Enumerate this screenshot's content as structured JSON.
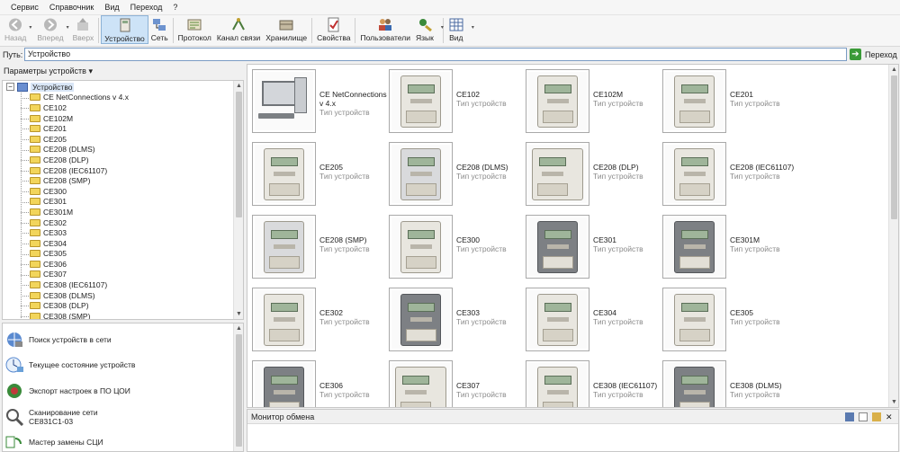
{
  "menu": [
    "Сервис",
    "Справочник",
    "Вид",
    "Переход",
    "?"
  ],
  "toolbar": {
    "back": "Назад",
    "forward": "Вперед",
    "up": "Вверх",
    "device": "Устройство",
    "network": "Сеть",
    "protocol": "Протокол",
    "channel": "Канал связи",
    "storage": "Хранилище",
    "properties": "Свойства",
    "users": "Пользователи",
    "language": "Язык",
    "view": "Вид"
  },
  "path": {
    "label": "Путь:",
    "value": "Устройство",
    "go_label": "Переход"
  },
  "left_panel": {
    "header": "Параметры устройств ▾",
    "tree_root": "Устройство",
    "tree_items": [
      "CE NetConnections v 4.x",
      "CE102",
      "CE102M",
      "CE201",
      "CE205",
      "CE208 (DLMS)",
      "CE208 (DLP)",
      "CE208 (IEC61107)",
      "CE208 (SMP)",
      "CE300",
      "CE301",
      "CE301M",
      "CE302",
      "CE303",
      "CE304",
      "CE305",
      "CE306",
      "CE307",
      "CE308 (IEC61107)",
      "CE308 (DLMS)",
      "CE308 (DLP)",
      "CE308 (SMP)"
    ],
    "tasks": [
      {
        "label": "Поиск устройств в сети",
        "icon": "network-search-icon"
      },
      {
        "label": "Текущее состояние устройств",
        "icon": "device-status-icon"
      },
      {
        "label": "Экспорт настроек в ПО ЦОИ",
        "icon": "export-icon"
      },
      {
        "label": "Сканирование сети",
        "label2": "CE831C1-03",
        "icon": "magnifier-icon"
      },
      {
        "label": "Мастер замены СЦИ",
        "icon": "replace-wizard-icon"
      }
    ]
  },
  "grid": {
    "subtitle": "Тип устройств",
    "items": [
      {
        "name": "CE NetConnections v 4.x",
        "kind": "pc"
      },
      {
        "name": "CE102",
        "kind": "meter"
      },
      {
        "name": "CE102M",
        "kind": "meter"
      },
      {
        "name": "CE201",
        "kind": "meter"
      },
      {
        "name": "CE205",
        "kind": "meter"
      },
      {
        "name": "CE208 (DLMS)",
        "kind": "meter-grey"
      },
      {
        "name": "CE208 (DLP)",
        "kind": "meter-wide"
      },
      {
        "name": "CE208 (IEC61107)",
        "kind": "meter"
      },
      {
        "name": "CE208 (SMP)",
        "kind": "meter-grey"
      },
      {
        "name": "CE300",
        "kind": "meter"
      },
      {
        "name": "CE301",
        "kind": "meter-dark"
      },
      {
        "name": "CE301M",
        "kind": "meter-dark"
      },
      {
        "name": "CE302",
        "kind": "meter"
      },
      {
        "name": "CE303",
        "kind": "meter-dark"
      },
      {
        "name": "CE304",
        "kind": "meter"
      },
      {
        "name": "CE305",
        "kind": "meter"
      },
      {
        "name": "CE306",
        "kind": "meter-dark"
      },
      {
        "name": "CE307",
        "kind": "meter-wide"
      },
      {
        "name": "CE308  (IEC61107)",
        "kind": "meter"
      },
      {
        "name": "CE308 (DLMS)",
        "kind": "meter-dark"
      }
    ]
  },
  "monitor": {
    "title": "Монитор обмена"
  },
  "colors": {
    "accent": "#cde3f7",
    "selection": "#d9e6f6",
    "go_green": "#3a9a38"
  }
}
